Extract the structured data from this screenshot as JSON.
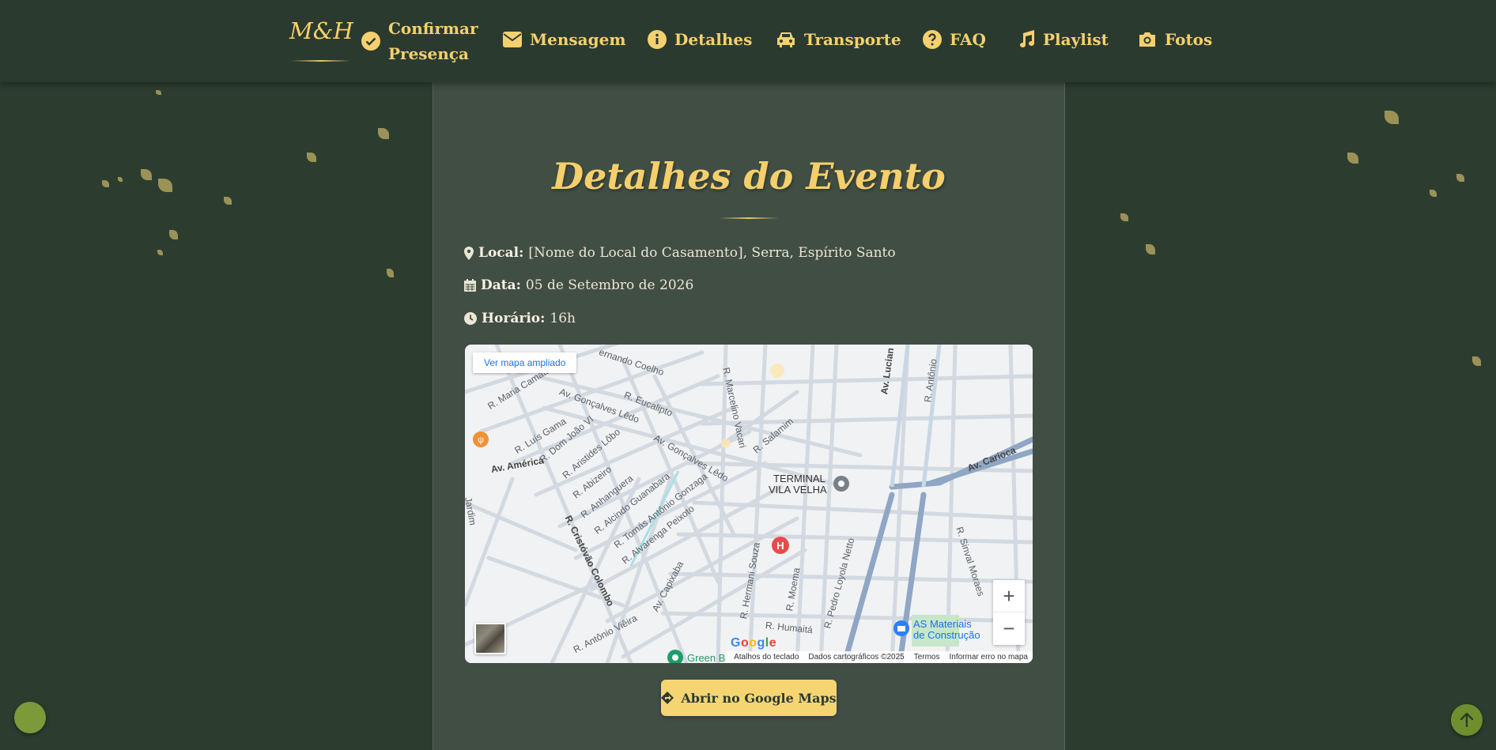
{
  "nav": {
    "brand": "M&H",
    "items": [
      {
        "label_line1": "Confirmar",
        "label_line2": "Presença",
        "icon": "check-circle-icon"
      },
      {
        "label": "Mensagem",
        "icon": "envelope-icon"
      },
      {
        "label": "Detalhes",
        "icon": "info-circle-icon"
      },
      {
        "label": "Transporte",
        "icon": "car-icon"
      },
      {
        "label": "FAQ",
        "icon": "question-circle-icon"
      },
      {
        "label": "Playlist",
        "icon": "music-note-icon"
      },
      {
        "label": "Fotos",
        "icon": "camera-icon"
      }
    ]
  },
  "event": {
    "title": "Detalhes do Evento",
    "local_label": "Local:",
    "local_value": "[Nome do Local do Casamento], Serra, Espírito Santo",
    "date_label": "Data:",
    "date_value": "05 de Setembro de 2026",
    "time_label": "Horário:",
    "time_value": "16h"
  },
  "map": {
    "view_larger": "Ver mapa ampliado",
    "google": "Google",
    "footer": {
      "shortcuts": "Atalhos do teclado",
      "data": "Dados cartográficos ©2025",
      "terms": "Termos",
      "report": "Informar erro no mapa"
    },
    "labels": {
      "fernando_coelho": "ernando Coelho",
      "maria_camata": "R. Maria Camata",
      "goncalves_ledo_1": "Av. Gonçalves Lêdo",
      "eucalipto": "R. Eucalipto",
      "marcelino": "R. Marcelino Vacari",
      "luis_gama": "R. Luís Gama",
      "dom_joao": "R. Dom João VI",
      "aristides": "R. Aristides Lôbo",
      "salamim": "R. Salamim",
      "goncalves_ledo_2": "Av. Gonçalves Lêdo",
      "america": "Av. América",
      "abizeiro": "R. Abizeiro",
      "anhanguera": "R. Anhanguera",
      "alcindo": "R. Alcindo Guanabara",
      "tomas": "R. Tomás Antônio Gonzaga",
      "alvarenga": "R. Alvarenga Peixoto",
      "cristovao": "R. Cristóvão Colombo",
      "capixaba": "Av. Capixaba",
      "antonio_vieira": "R. Antônio Viêira",
      "hermani": "R. Hermani Souza",
      "moema": "R. Moema",
      "pedro_loyola": "R. Pedro Loyola Netto",
      "humaita": "R. Humaitá",
      "luciano": "Av. Lucian",
      "antonio_r": "R. Antônio",
      "carioca": "Av. Carioca",
      "sinval": "R. Sinval Moraes",
      "jardim": "Jardim",
      "terminal_1": "TERMINAL",
      "terminal_2": "VILA VELHA",
      "as_materiais_1": "AS Materiais",
      "as_materiais_2": "de Construção",
      "green_b": "Green B"
    }
  },
  "button": {
    "label": "Abrir no Google Maps",
    "icon": "directions-diamond-icon"
  },
  "colors": {
    "background": "#2c3d30",
    "card": "#414e44",
    "accent": "#f5cf6b",
    "button": "#f5d572"
  }
}
